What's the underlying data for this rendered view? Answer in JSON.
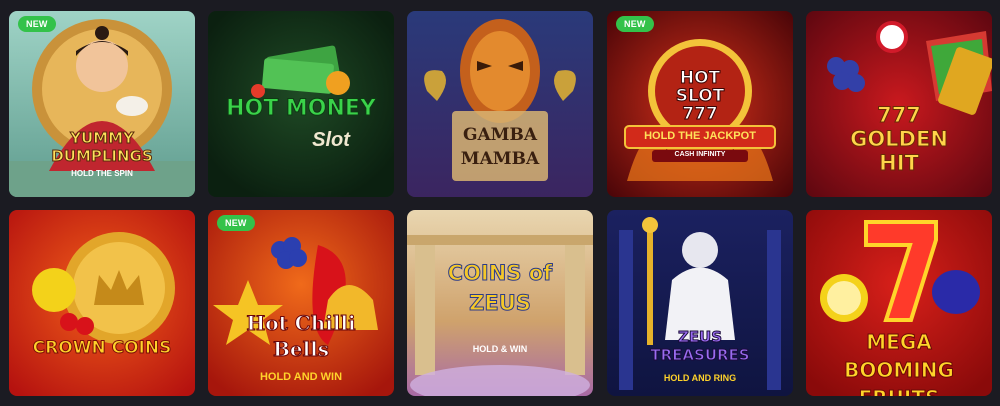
{
  "badge_label": "NEW",
  "games": [
    {
      "title": "YUMMY DUMPLINGS",
      "subtitle": "HOLD THE SPIN",
      "is_new": true
    },
    {
      "title": "HOT MONEY",
      "subtitle": "Slot",
      "is_new": false
    },
    {
      "title": "GAMBA MAMBA",
      "subtitle": "",
      "is_new": false
    },
    {
      "title": "HOT SLOT 777",
      "subtitle": "HOLD THE JACKPOT",
      "tagline": "CASH INFINITY",
      "is_new": true
    },
    {
      "title": "777 GOLDEN HIT",
      "subtitle": "",
      "is_new": false
    },
    {
      "title": "CROWN COINS",
      "subtitle": "",
      "is_new": false
    },
    {
      "title": "Hot Chilli Bells",
      "subtitle": "HOLD AND WIN",
      "is_new": true
    },
    {
      "title": "COINS of ZEUS",
      "subtitle": "HOLD & WIN",
      "is_new": false
    },
    {
      "title": "ZEUS TREASURES",
      "subtitle": "HOLD AND RING",
      "is_new": false
    },
    {
      "title": "MEGA BOOMING FRUITS",
      "subtitle": "",
      "is_new": false
    }
  ],
  "colors": {
    "page_bg": "#1b1b22",
    "badge_bg": "#33c24a"
  }
}
